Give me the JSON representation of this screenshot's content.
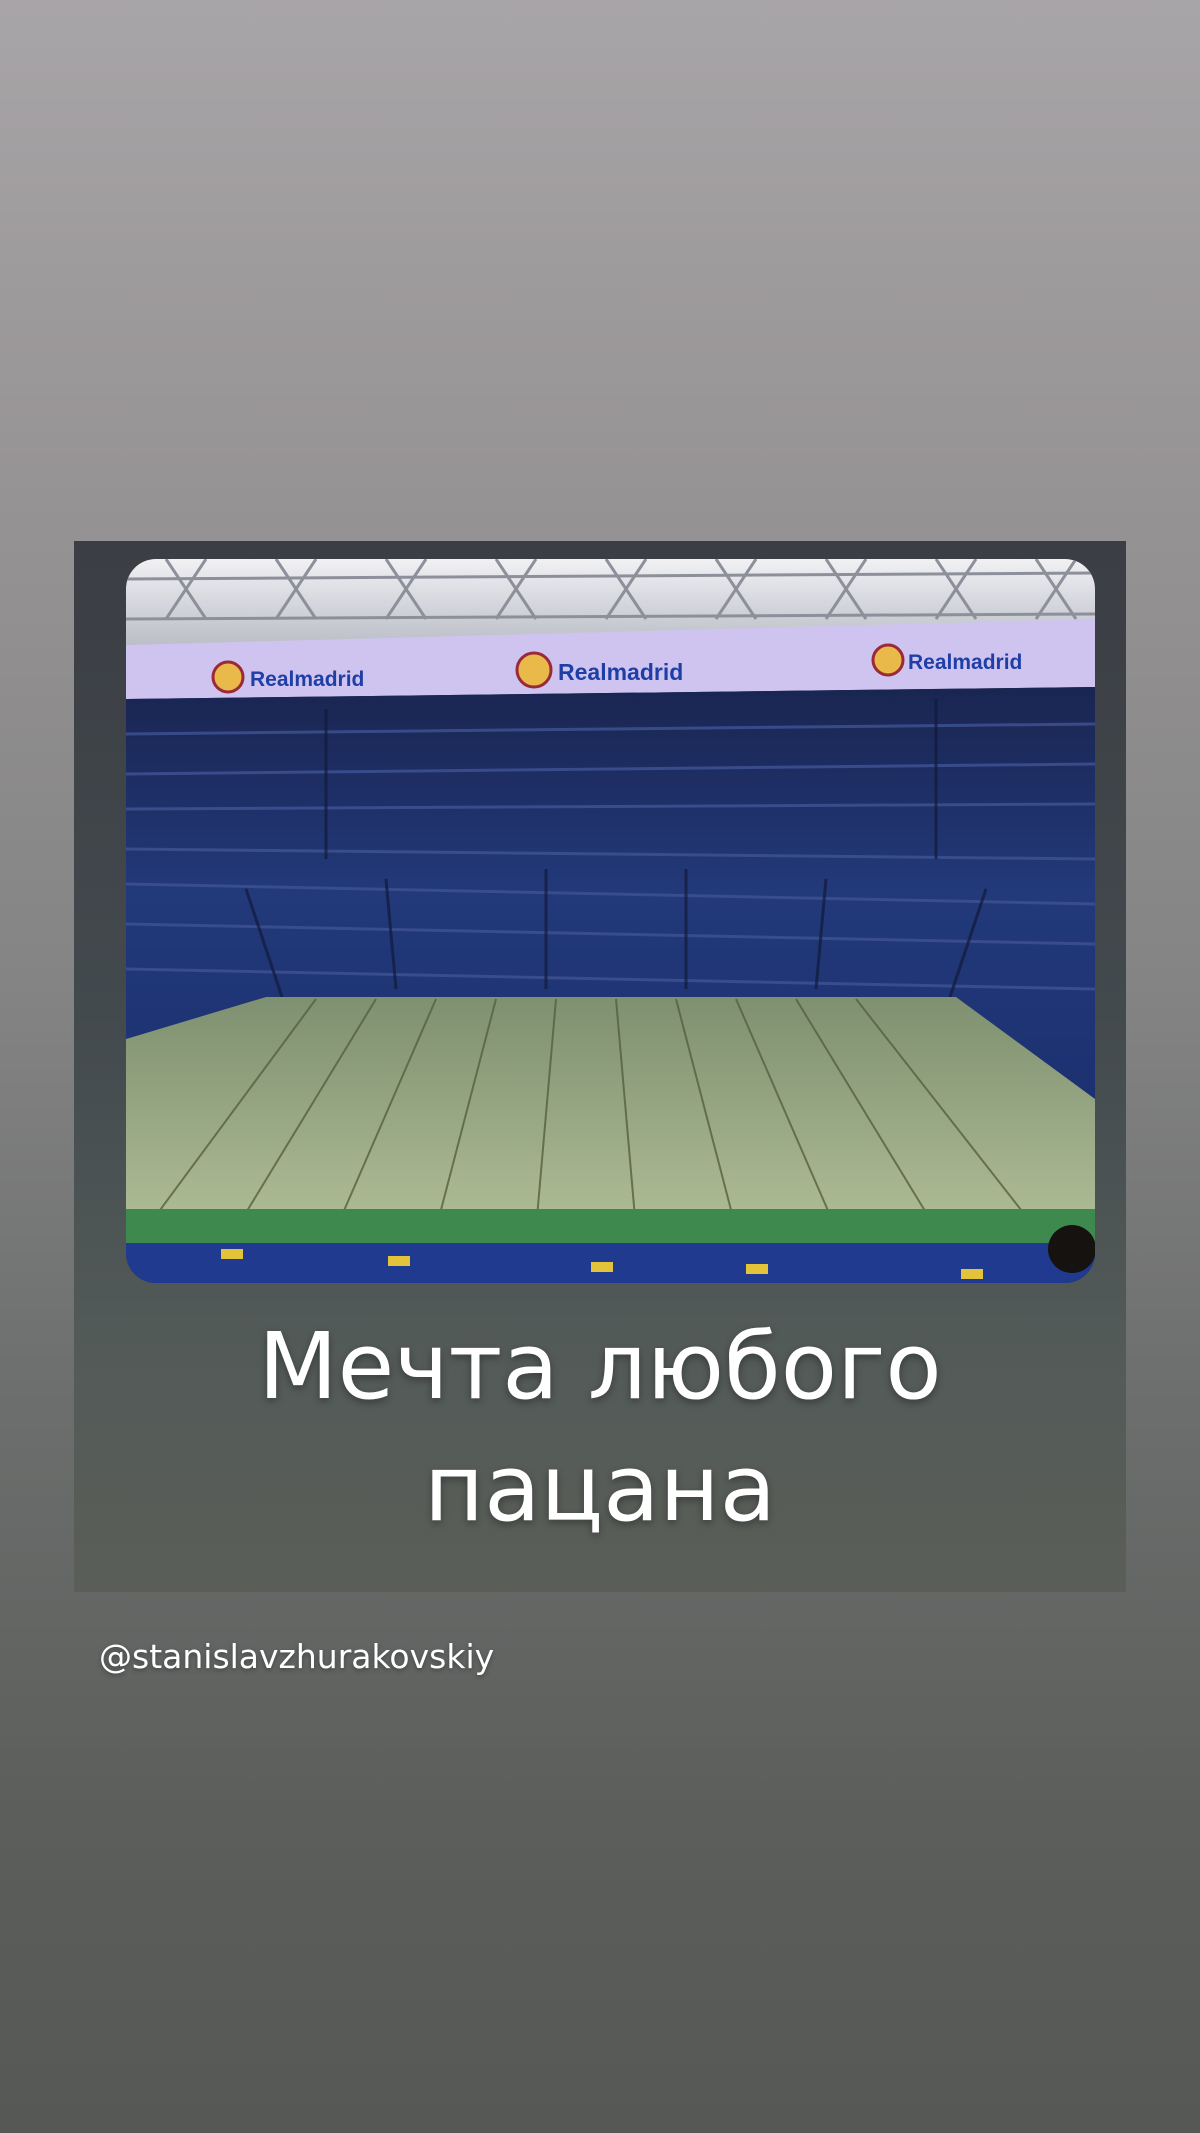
{
  "story": {
    "photo_banner_brand": "Realmadrid",
    "caption_line1": "Мечта любого",
    "caption_line2": "пацана",
    "mention": "@stanislavzhurakovskiy"
  },
  "colors": {
    "banner": "#cfc4ef",
    "brand_text": "#1f3fa6",
    "seats": "#1d2f6b",
    "pitch": "#8fa27a"
  }
}
